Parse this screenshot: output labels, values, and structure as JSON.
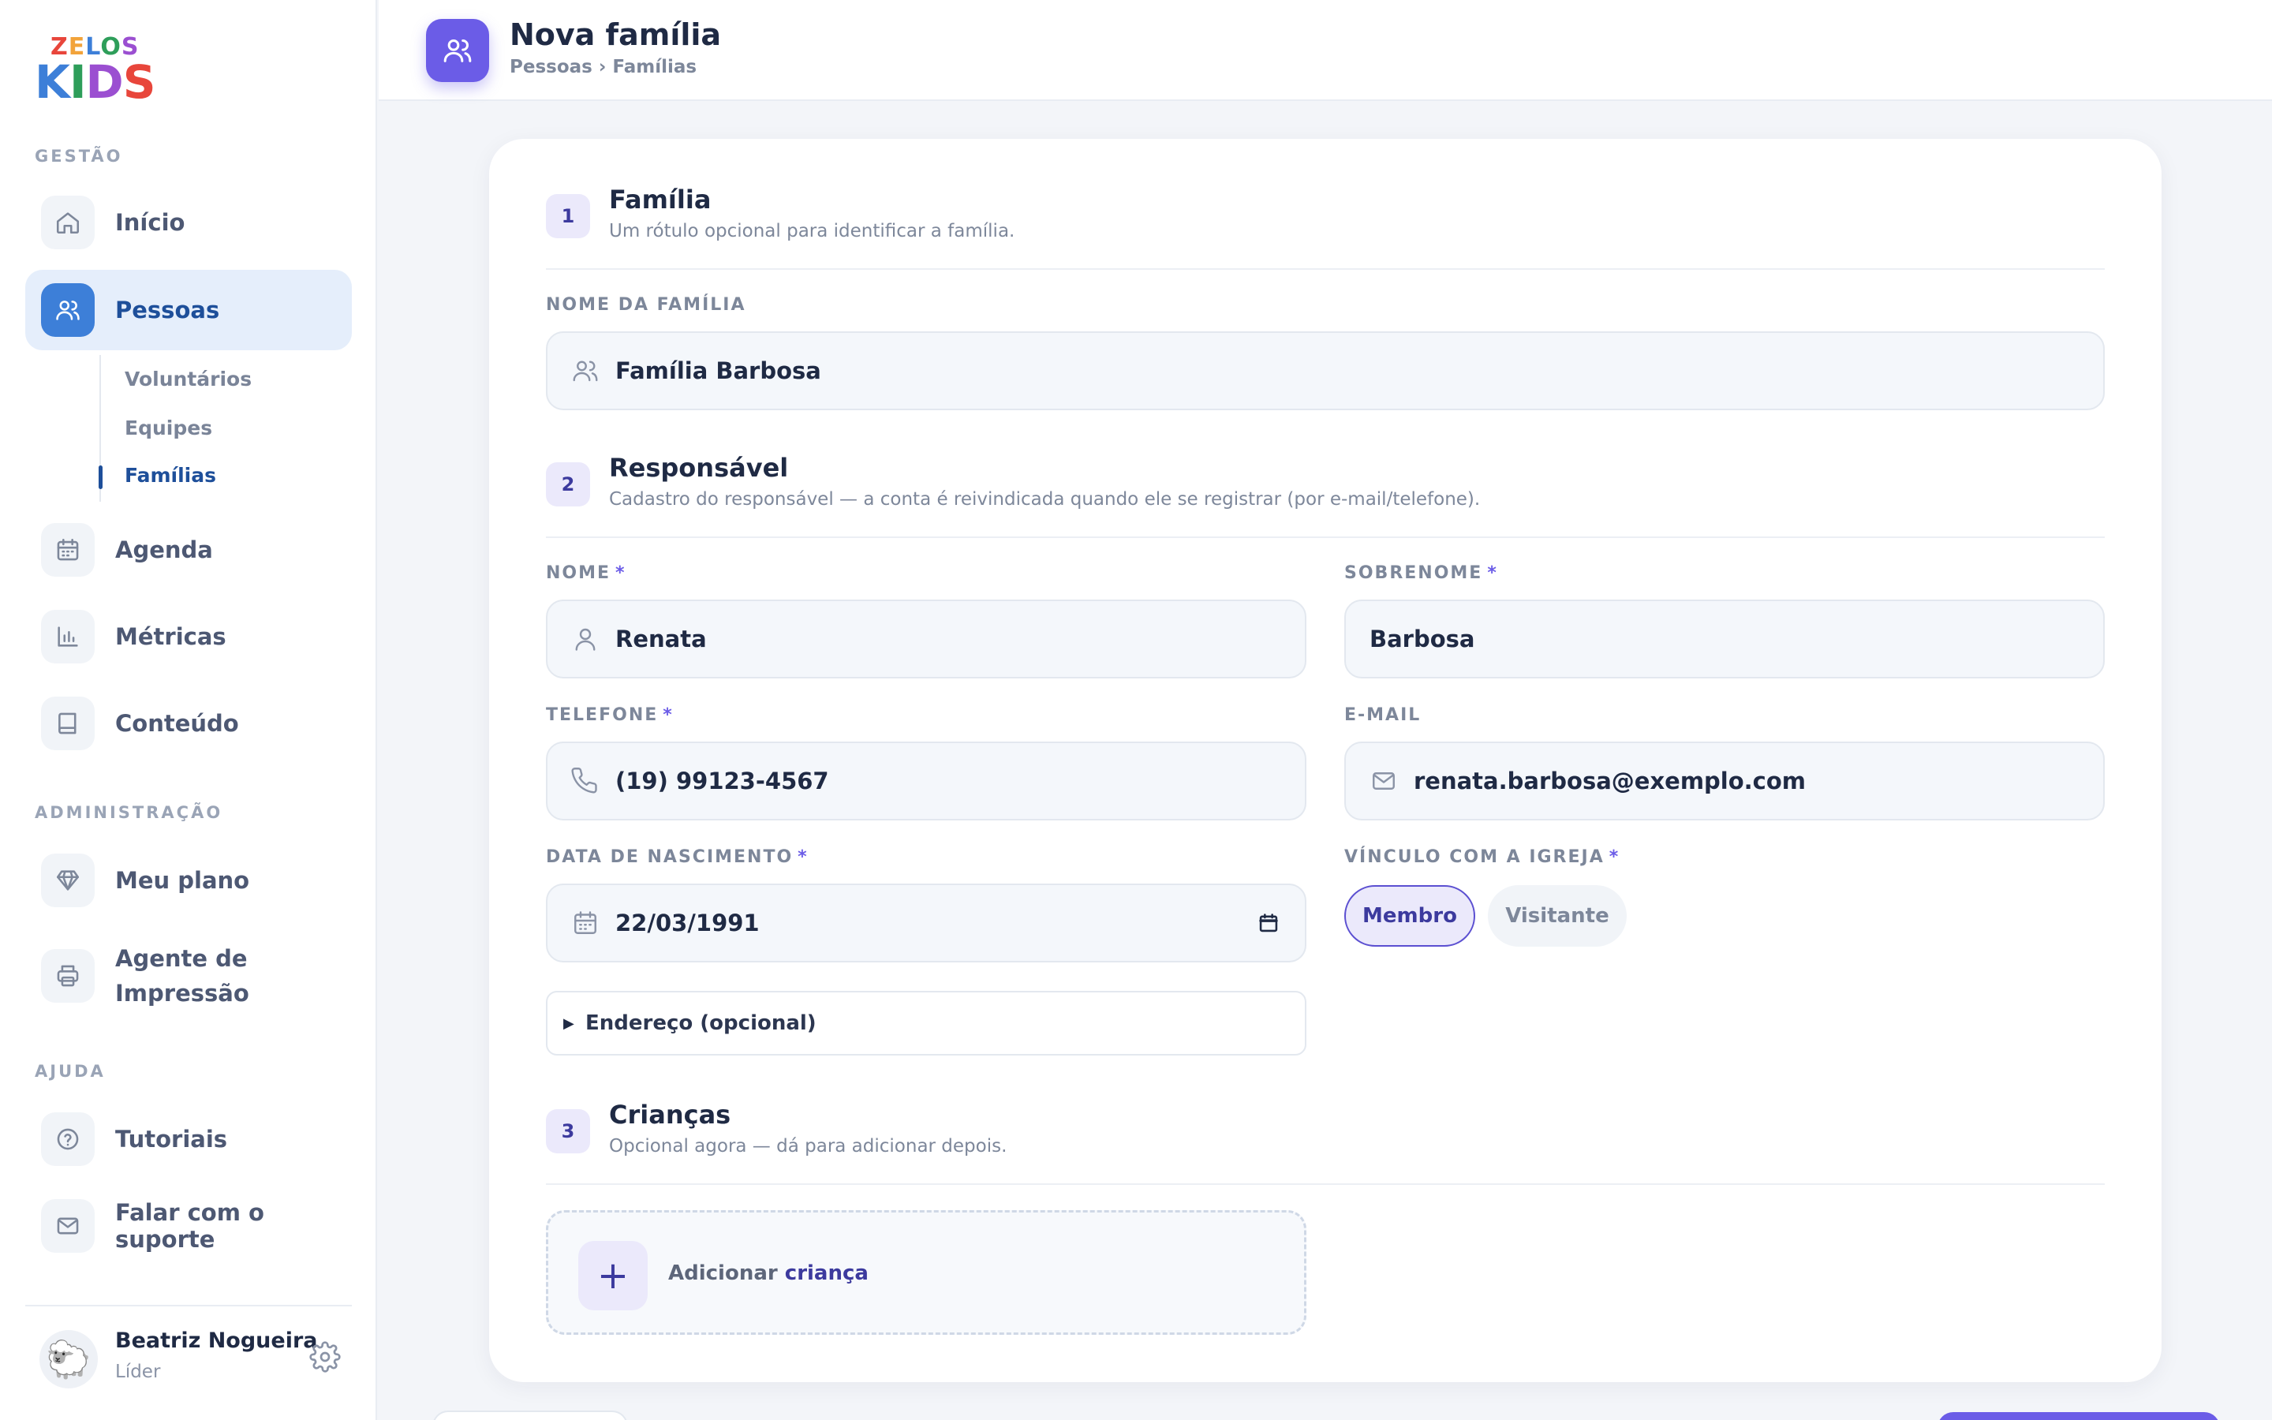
{
  "brand": {
    "logo_top": "ZELOS",
    "logo_bottom": "KIDS"
  },
  "sidebar": {
    "section_gestao": "GESTÃO",
    "section_admin": "ADMINISTRAÇÃO",
    "section_ajuda": "AJUDA",
    "items": {
      "inicio": "Início",
      "pessoas": "Pessoas",
      "agenda": "Agenda",
      "metricas": "Métricas",
      "conteudo": "Conteúdo",
      "meu_plano": "Meu plano",
      "agente_l1": "Agente de",
      "agente_l2": "Impressão",
      "tutoriais": "Tutoriais",
      "suporte": "Falar com o suporte"
    },
    "subnav": {
      "voluntarios": "Voluntários",
      "equipes": "Equipes",
      "familias": "Famílias"
    },
    "user": {
      "name": "Beatriz Nogueira",
      "role": "Líder",
      "avatar": "🐑"
    }
  },
  "header": {
    "title": "Nova família",
    "breadcrumb": "Pessoas › Famílias"
  },
  "form": {
    "familia": {
      "step": "1",
      "title": "Família",
      "subtitle": "Um rótulo opcional para identificar a família.",
      "nome_label": "NOME DA FAMÍLIA",
      "nome_value": "Família Barbosa"
    },
    "responsavel": {
      "step": "2",
      "title": "Responsável",
      "subtitle": "Cadastro do responsável — a conta é reivindicada quando ele se registrar (por e-mail/telefone).",
      "nome_label": "NOME",
      "nome_value": "Renata",
      "sobrenome_label": "SOBRENOME",
      "sobrenome_value": "Barbosa",
      "telefone_label": "TELEFONE",
      "telefone_value": "(19) 99123-4567",
      "email_label": "E-MAIL",
      "email_value": "renata.barbosa@exemplo.com",
      "nascimento_label": "DATA DE NASCIMENTO",
      "nascimento_value": "22/03/1991",
      "vinculo_label": "VÍNCULO COM A IGREJA",
      "vinculo_options": {
        "membro": "Membro",
        "visitante": "Visitante"
      },
      "required_mark": "*",
      "endereco_toggle": "Endereço (opcional)"
    },
    "criancas": {
      "step": "3",
      "title": "Crianças",
      "subtitle": "Opcional agora — dá para adicionar depois.",
      "add_prefix": "Adicionar",
      "add_bold": "criança",
      "plus": "+"
    }
  },
  "colors": {
    "accent": "#6b5ce7",
    "active_nav": "#3d7fd8",
    "active_text": "#1e4f9a"
  }
}
